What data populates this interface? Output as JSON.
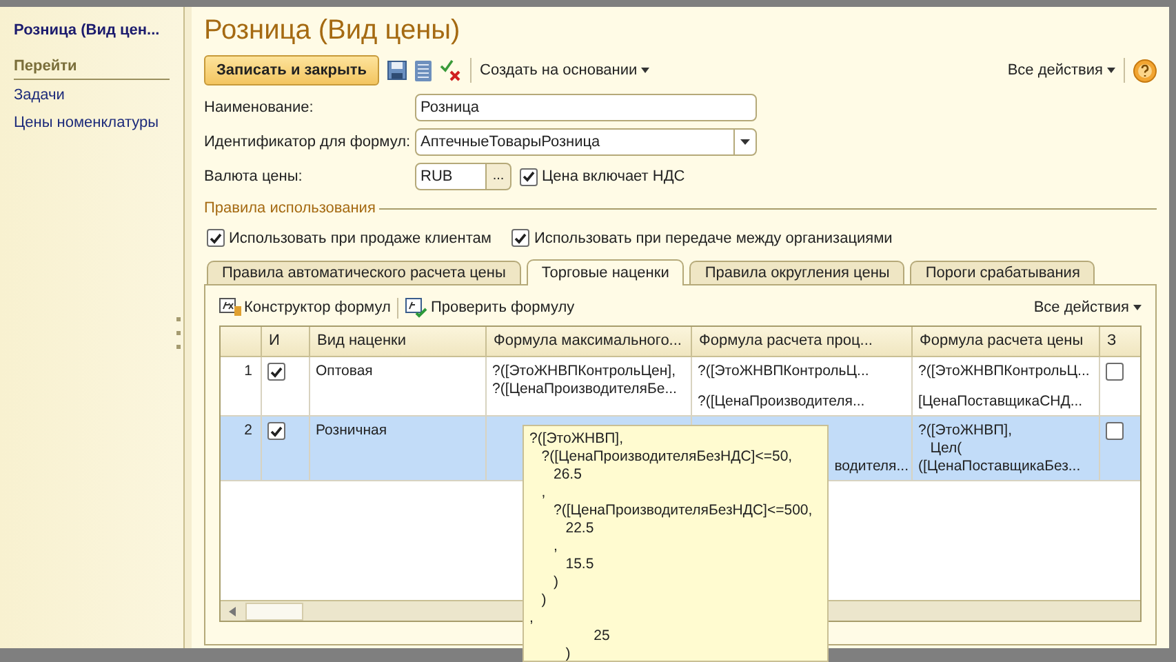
{
  "sidebar": {
    "title": "Розница (Вид цен...",
    "section": "Перейти",
    "items": [
      "Задачи",
      "Цены номенклатуры"
    ]
  },
  "form": {
    "title": "Розница (Вид цены)",
    "toolbar": {
      "primary": "Записать и закрыть",
      "create_based": "Создать на основании",
      "all_actions": "Все действия"
    },
    "fields": [
      {
        "kind": "text",
        "label": "Наименование:",
        "value": "Розница"
      },
      {
        "kind": "select",
        "label": "Идентификатор для формул:",
        "value": "АптечныеТоварыРозница"
      },
      {
        "kind": "currency",
        "label": "Валюта цены:",
        "value": "RUB",
        "button": "...",
        "check_label": "Цена включает НДС",
        "checked": true
      }
    ],
    "group": {
      "title": "Правила использования",
      "checks": [
        {
          "label": "Использовать при продаже клиентам",
          "checked": true
        },
        {
          "label": "Использовать при передаче между организациями",
          "checked": true
        }
      ]
    },
    "tabs": [
      {
        "label": "Правила автоматического расчета цены",
        "selected": false
      },
      {
        "label": "Торговые наценки",
        "selected": true
      },
      {
        "label": "Правила округления цены",
        "selected": false
      },
      {
        "label": "Пороги срабатывания",
        "selected": false
      }
    ],
    "tab_toolbar": {
      "constructor": "Конструктор формул",
      "check": "Проверить формулу",
      "all_actions": "Все действия"
    },
    "table": {
      "columns": [
        "",
        "И",
        "Вид наценки",
        "Формула максимального...",
        "Формула расчета проц...",
        "Формула расчета цены",
        "З"
      ],
      "rows": [
        {
          "n": "1",
          "used": true,
          "name": "Оптовая",
          "selected": false,
          "max": [
            "?([ЭтоЖНВПКонтрольЦен],",
            "?([ЦенаПроизводителяБе..."
          ],
          "pct": {
            "lines": [
              "?([ЭтоЖНВПКонтрольЦ..."
            ],
            "last": "?([ЦенаПроизводителя...",
            "covered": false
          },
          "price": {
            "lines": [
              "?([ЭтоЖНВПКонтрольЦ..."
            ],
            "last": "[ЦенаПоставщикаСНД..."
          },
          "z": false
        },
        {
          "n": "2",
          "used": true,
          "name": "Розничная",
          "selected": true,
          "max": [],
          "pct": {
            "last": "водителя...",
            "covered": true
          },
          "price": {
            "lines": [
              "?([ЭтоЖНВП],",
              "   Цел(",
              "([ЦенаПоставщикаБез..."
            ]
          },
          "z": false
        }
      ]
    }
  },
  "tooltip": {
    "lines": [
      "?([ЭтоЖНВП],",
      "   ?([ЦенаПроизводителяБезНДС]<=50,",
      "      26.5",
      "   ,",
      "      ?([ЦенаПроизводителяБезНДС]<=500,",
      "         22.5",
      "      ,",
      "         15.5",
      "      )",
      "   )",
      ",",
      "                25",
      "         )"
    ]
  }
}
